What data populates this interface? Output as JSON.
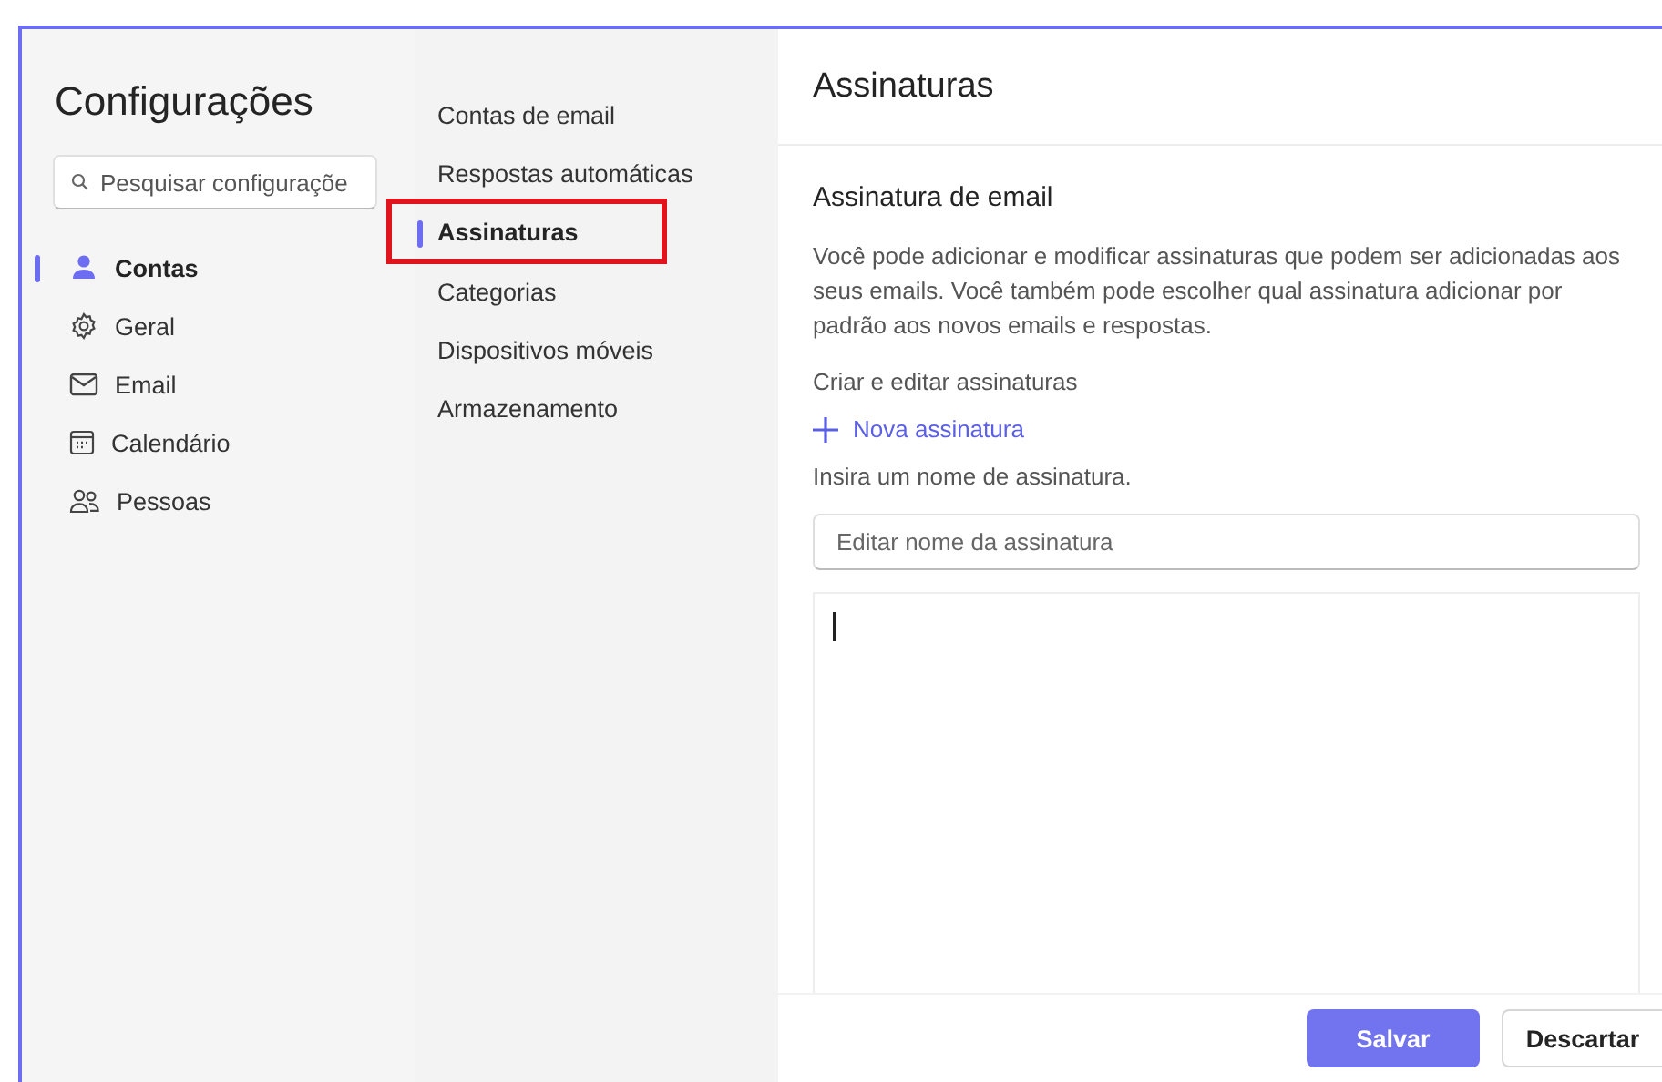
{
  "settings": {
    "title": "Configurações",
    "search": {
      "placeholder": "Pesquisar configuraçõe"
    },
    "categories": [
      {
        "label": "Contas",
        "selected": true
      },
      {
        "label": "Geral",
        "selected": false
      },
      {
        "label": "Email",
        "selected": false
      },
      {
        "label": "Calendário",
        "selected": false
      },
      {
        "label": "Pessoas",
        "selected": false
      }
    ]
  },
  "subsections": [
    {
      "label": "Contas de email",
      "selected": false,
      "highlighted": false
    },
    {
      "label": "Respostas automáticas",
      "selected": false,
      "highlighted": false
    },
    {
      "label": "Assinaturas",
      "selected": true,
      "highlighted": true
    },
    {
      "label": "Categorias",
      "selected": false,
      "highlighted": false
    },
    {
      "label": "Dispositivos móveis",
      "selected": false,
      "highlighted": false
    },
    {
      "label": "Armazenamento",
      "selected": false,
      "highlighted": false
    }
  ],
  "content": {
    "heading": "Assinaturas",
    "section_title": "Assinatura de email",
    "description": "Você pode adicionar e modificar assinaturas que podem ser adicionadas aos seus emails. Você também pode escolher qual assinatura adicionar por padrão aos novos emails e respostas.",
    "create_label": "Criar e editar assinaturas",
    "new_link": "Nova assinatura",
    "name_prompt": "Insira um nome de assinatura.",
    "name_field": {
      "placeholder": "Editar nome da assinatura"
    },
    "buttons": [
      {
        "label": "Salvar",
        "kind": "primary"
      },
      {
        "label": "Descartar",
        "kind": "secondary"
      }
    ]
  }
}
